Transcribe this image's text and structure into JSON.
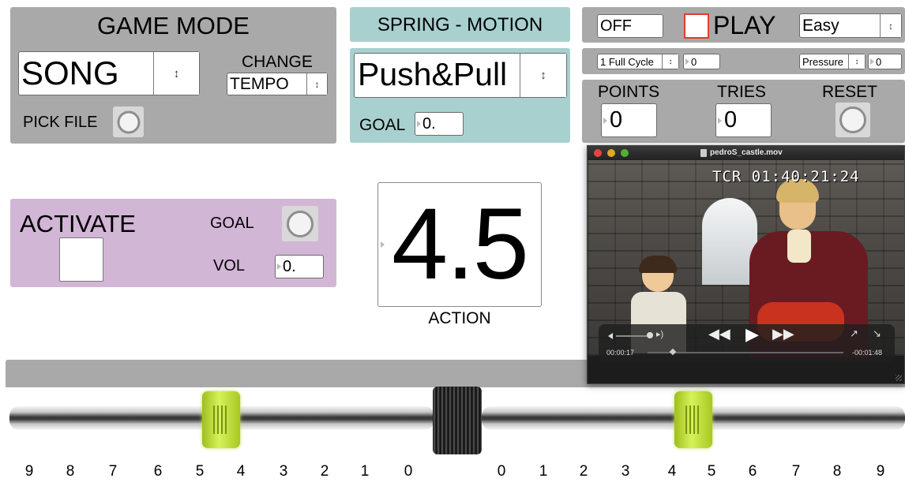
{
  "game_mode": {
    "title": "GAME MODE",
    "mode_value": "SONG",
    "change_label": "CHANGE",
    "change_value": "TEMPO",
    "pick_file_label": "PICK FILE"
  },
  "spring": {
    "title": "SPRING - MOTION",
    "motion_value": "Push&Pull",
    "goal_label": "GOAL",
    "goal_value": "0."
  },
  "play_panel": {
    "status_value": "OFF",
    "play_label": "PLAY",
    "difficulty_value": "Easy",
    "cycle_value": "1 Full Cycle",
    "cycle_number": "0",
    "sensor_value": "Pressure",
    "sensor_number": "0"
  },
  "scores": {
    "points_label": "POINTS",
    "points_value": "0",
    "tries_label": "TRIES",
    "tries_value": "0",
    "reset_label": "RESET"
  },
  "activate": {
    "title": "ACTIVATE",
    "goal_label": "GOAL",
    "vol_label": "VOL",
    "vol_value": "0."
  },
  "action": {
    "value": "4.5",
    "label": "ACTION"
  },
  "video": {
    "filename": "pedroS_castle.mov",
    "timecode": "TCR 01:40:21:24",
    "elapsed": "00:00:17",
    "remaining": "-00:01:48"
  },
  "slider": {
    "left_ticks": [
      "9",
      "8",
      "7",
      "6",
      "5",
      "4",
      "3",
      "2",
      "1",
      "0"
    ],
    "right_ticks": [
      "0",
      "1",
      "2",
      "3",
      "4",
      "5",
      "6",
      "7",
      "8",
      "9"
    ],
    "left_handle_value": 4.5,
    "right_handle_value": 4.5,
    "handle_color": "#b7dc2a",
    "spring_color": "#2a2a2a"
  },
  "colors": {
    "grey_panel": "#a9a9a9",
    "teal_panel": "#a8d0ce",
    "purple_panel": "#d2b6d6",
    "play_toggle_border": "#e03c32"
  }
}
